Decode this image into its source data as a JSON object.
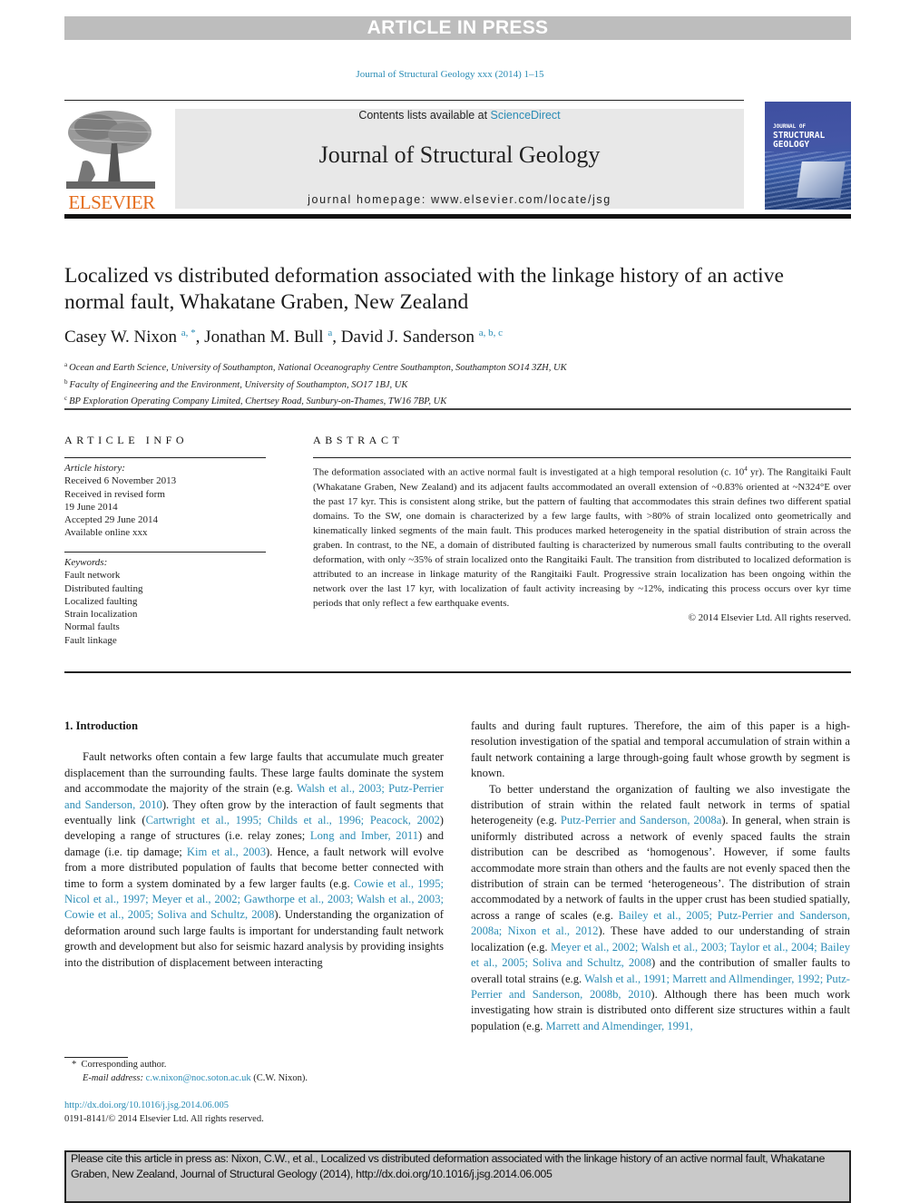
{
  "banner": {
    "text": "ARTICLE IN PRESS"
  },
  "journal_ref": "Journal of Structural Geology xxx (2014) 1–15",
  "header": {
    "publisher_logo_text": "ELSEVIER",
    "contents_prefix": "Contents lists available at ",
    "contents_link": "ScienceDirect",
    "journal_title": "Journal of Structural Geology",
    "homepage": "journal homepage: www.elsevier.com/locate/jsg",
    "cover": {
      "line1": "JOURNAL OF",
      "line2": "STRUCTURAL",
      "line3": "GEOLOGY"
    }
  },
  "article": {
    "title": "Localized vs distributed deformation associated with the linkage history of an active normal fault, Whakatane Graben, New Zealand",
    "authors": [
      {
        "name": "Casey W. Nixon",
        "sup": "a, *"
      },
      {
        "name": "Jonathan M. Bull",
        "sup": "a"
      },
      {
        "name": "David J. Sanderson",
        "sup": "a, b, c"
      }
    ],
    "affiliations": [
      {
        "mark": "a",
        "text": "Ocean and Earth Science, University of Southampton, National Oceanography Centre Southampton, Southampton SO14 3ZH, UK"
      },
      {
        "mark": "b",
        "text": "Faculty of Engineering and the Environment, University of Southampton, SO17 1BJ, UK"
      },
      {
        "mark": "c",
        "text": "BP Exploration Operating Company Limited, Chertsey Road, Sunbury-on-Thames, TW16 7BP, UK"
      }
    ]
  },
  "article_info": {
    "heading": "ARTICLE INFO",
    "history_label": "Article history:",
    "history": [
      "Received 6 November 2013",
      "Received in revised form",
      "19 June 2014",
      "Accepted 29 June 2014",
      "Available online xxx"
    ],
    "keywords_label": "Keywords:",
    "keywords": [
      "Fault network",
      "Distributed faulting",
      "Localized faulting",
      "Strain localization",
      "Normal faults",
      "Fault linkage"
    ]
  },
  "abstract": {
    "heading": "ABSTRACT",
    "part1": "The deformation associated with an active normal fault is investigated at a high temporal resolution (c. 10",
    "sup": "4",
    "part2": " yr). The Rangitaiki Fault (Whakatane Graben, New Zealand) and its adjacent faults accommodated an overall extension of ~0.83% oriented at ~N324°E over the past 17 kyr. This is consistent along strike, but the pattern of faulting that accommodates this strain defines two different spatial domains. To the SW, one domain is characterized by a few large faults, with >80% of strain localized onto geometrically and kinematically linked segments of the main fault. This produces marked heterogeneity in the spatial distribution of strain across the graben. In contrast, to the NE, a domain of distributed faulting is characterized by numerous small faults contributing to the overall deformation, with only ~35% of strain localized onto the Rangitaiki Fault. The transition from distributed to localized deformation is attributed to an increase in linkage maturity of the Rangitaiki Fault. Progressive strain localization has been ongoing within the network over the last 17 kyr, with localization of fault activity increasing by ~12%, indicating this process occurs over kyr time periods that only reflect a few earthquake events.",
    "copyright": "© 2014 Elsevier Ltd. All rights reserved."
  },
  "body": {
    "section_title": "1.  Introduction",
    "left": [
      {
        "t": "Fault networks often contain a few large faults that accumulate much greater displacement than the surrounding faults. These large faults dominate the system and accommodate the majority of the strain (e.g. "
      },
      {
        "l": "Walsh et al., 2003; Putz-Perrier and Sanderson, 2010"
      },
      {
        "t": "). They often grow by the interaction of fault segments that eventually link ("
      },
      {
        "l": "Cartwright et al., 1995; Childs et al., 1996; Peacock, 2002"
      },
      {
        "t": ") developing a range of structures (i.e. relay zones; "
      },
      {
        "l": "Long and Imber, 2011"
      },
      {
        "t": ") and damage (i.e. tip damage; "
      },
      {
        "l": "Kim et al., 2003"
      },
      {
        "t": "). Hence, a fault network will evolve from a more distributed population of faults that become better connected with time to form a system dominated by a few larger faults (e.g. "
      },
      {
        "l": "Cowie et al., 1995; Nicol et al., 1997; Meyer et al., 2002; Gawthorpe et al., 2003; Walsh et al., 2003; Cowie et al., 2005; Soliva and Schultz, 2008"
      },
      {
        "t": "). Understanding the organization of deformation around such large faults is important for understanding fault network growth and development but also for seismic hazard analysis by providing insights into the distribution of displacement between interacting"
      }
    ],
    "right_p1": "faults and during fault ruptures. Therefore, the aim of this paper is a high-resolution investigation of the spatial and temporal accumulation of strain within a fault network containing a large through-going fault whose growth by segment is known.",
    "right_p2": [
      {
        "t": "To better understand the organization of faulting we also investigate the distribution of strain within the related fault network in terms of spatial heterogeneity (e.g. "
      },
      {
        "l": "Putz-Perrier and Sanderson, 2008a"
      },
      {
        "t": "). In general, when strain is uniformly distributed across a network of evenly spaced faults the strain distribution can be described as ‘homogenous’. However, if some faults accommodate more strain than others and the faults are not evenly spaced then the distribution of strain can be termed ‘heterogeneous’. The distribution of strain accommodated by a network of faults in the upper crust has been studied spatially, across a range of scales (e.g. "
      },
      {
        "l": "Bailey et al., 2005; Putz-Perrier and Sanderson, 2008a; Nixon et al., 2012"
      },
      {
        "t": "). These have added to our understanding of strain localization (e.g. "
      },
      {
        "l": "Meyer et al., 2002; Walsh et al., 2003; Taylor et al., 2004; Bailey et al., 2005; Soliva and Schultz, 2008"
      },
      {
        "t": ") and the contribution of smaller faults to overall total strains (e.g. "
      },
      {
        "l": "Walsh et al., 1991; Marrett and Allmendinger, 1992; Putz-Perrier and Sanderson, 2008b, 2010"
      },
      {
        "t": "). Although there has been much work investigating how strain is distributed onto different size structures within a fault population (e.g. "
      },
      {
        "l": "Marrett and Almendinger, 1991,"
      }
    ]
  },
  "footnote": {
    "mark": "*",
    "corresponding": "Corresponding author.",
    "email_label": "E-mail address:",
    "email": "c.w.nixon@noc.soton.ac.uk",
    "email_suffix": " (C.W. Nixon).",
    "doi": "http://dx.doi.org/10.1016/j.jsg.2014.06.005",
    "issn": "0191-8141/© 2014 Elsevier Ltd. All rights reserved."
  },
  "citation_box": {
    "text": "Please cite this article in press as: Nixon, C.W., et al., Localized vs distributed deformation associated with the linkage history of an active normal fault, Whakatane Graben, New Zealand, Journal of Structural Geology (2014), http://dx.doi.org/10.1016/j.jsg.2014.06.005"
  }
}
